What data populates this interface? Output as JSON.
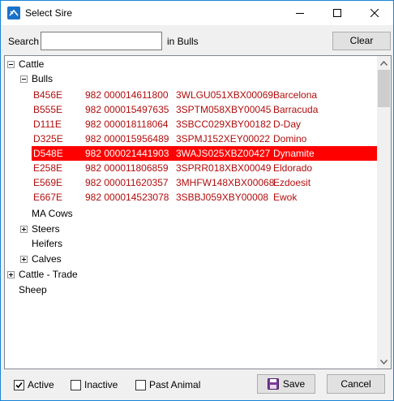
{
  "window": {
    "title": "Select Sire"
  },
  "search": {
    "label": "Search",
    "value": "",
    "scope_label": "in Bulls",
    "clear_label": "Clear"
  },
  "tree": {
    "cattle": "Cattle",
    "bulls": "Bulls",
    "bull_rows": [
      {
        "id": "B456E",
        "nlis": "982 000014611800",
        "code": "3WLGU051XBX00069",
        "name": "Barcelona"
      },
      {
        "id": "B555E",
        "nlis": "982 000015497635",
        "code": "3SPTM058XBY00045",
        "name": "Barracuda"
      },
      {
        "id": "D111E",
        "nlis": "982 000018118064",
        "code": "3SBCC029XBY00182",
        "name": "D-Day"
      },
      {
        "id": "D325E",
        "nlis": "982 000015956489",
        "code": "3SPMJ152XEY00022",
        "name": "Domino"
      },
      {
        "id": "D548E",
        "nlis": "982 000021441903",
        "code": "3WAJS025XBZ00427",
        "name": "Dynamite"
      },
      {
        "id": "E258E",
        "nlis": "982 000011806859",
        "code": "3SPRR018XBX00049",
        "name": "Eldorado"
      },
      {
        "id": "E569E",
        "nlis": "982 000011620357",
        "code": "3MHFW148XBX00068",
        "name": "Ezdoesit"
      },
      {
        "id": "E667E",
        "nlis": "982 000014523078",
        "code": "3SBBJ059XBY00008",
        "name": "Ewok"
      }
    ],
    "selected_index": 4,
    "ma_cows": "MA Cows",
    "steers": "Steers",
    "heifers": "Heifers",
    "calves": "Calves",
    "cattle_trade": "Cattle - Trade",
    "sheep": "Sheep"
  },
  "filters": {
    "active": {
      "label": "Active",
      "checked": true
    },
    "inactive": {
      "label": "Inactive",
      "checked": false
    },
    "past_animal": {
      "label": "Past Animal",
      "checked": false
    }
  },
  "buttons": {
    "save": "Save",
    "cancel": "Cancel"
  },
  "colors": {
    "selected_row": "#ff0000",
    "bull_text": "#b10d0d",
    "accent": "#1883d7"
  }
}
